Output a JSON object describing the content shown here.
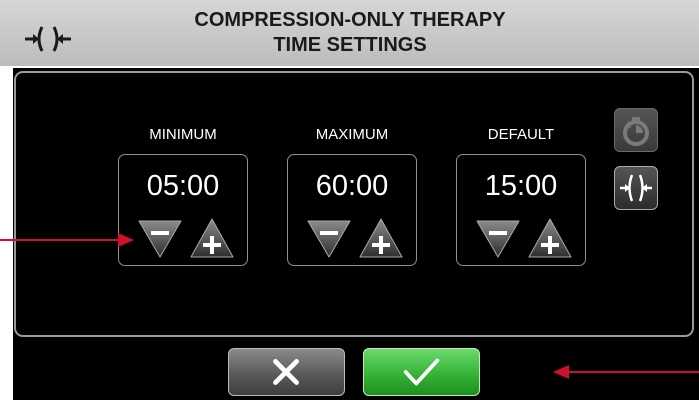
{
  "header": {
    "title_line1": "COMPRESSION-ONLY THERAPY",
    "title_line2": "TIME SETTINGS",
    "icon": "compression-icon"
  },
  "settings": [
    {
      "label": "MINIMUM",
      "value": "05:00"
    },
    {
      "label": "MAXIMUM",
      "value": "60:00"
    },
    {
      "label": "DEFAULT",
      "value": "15:00"
    }
  ],
  "side_buttons": {
    "timer_icon": "timer-icon",
    "compression_icon": "compression-icon"
  },
  "footer": {
    "cancel_icon": "close-icon",
    "confirm_icon": "check-icon"
  },
  "colors": {
    "screen": "#000000",
    "header": "#c8c8c8",
    "confirm": "#3cb83c",
    "arrow": "#d0102a"
  }
}
